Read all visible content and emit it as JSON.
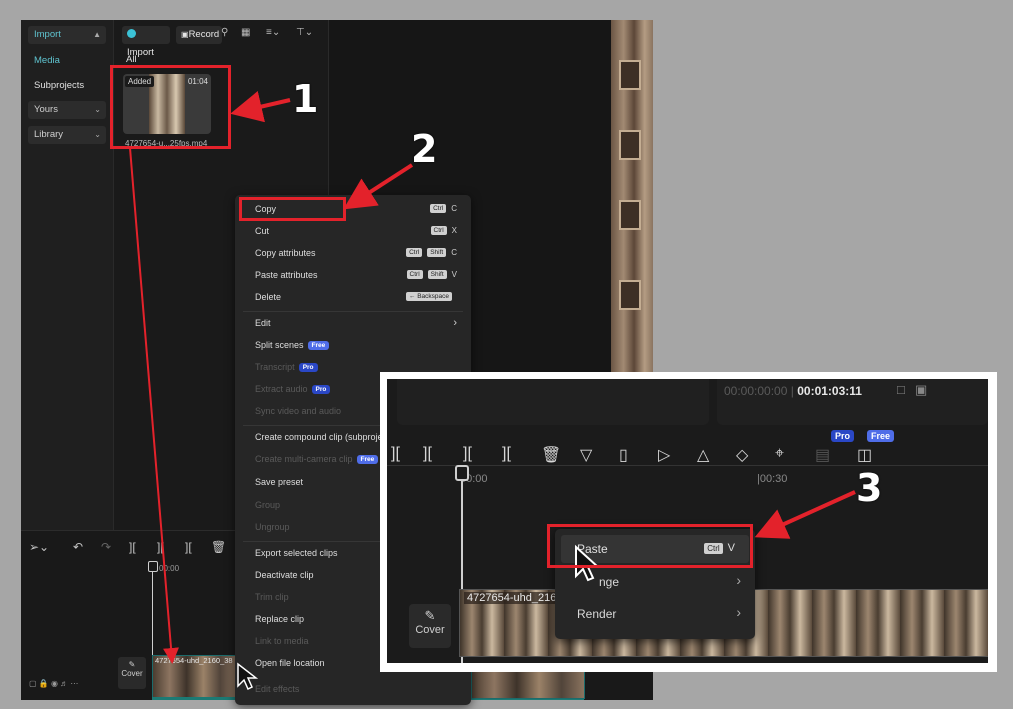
{
  "left_nav": {
    "import_label": "Import",
    "media_label": "Media",
    "subprojects_label": "Subprojects",
    "yours_label": "Yours",
    "library_label": "Library"
  },
  "media_toolbar": {
    "import_label": "Import",
    "record_label": "Record",
    "filter_all": "All"
  },
  "media_item": {
    "badge": "Added",
    "duration": "01:04",
    "filename": "4727654-u...25fps.mp4"
  },
  "context_menu": {
    "items": [
      {
        "label": "Copy",
        "key1": "Ctrl",
        "key2": "",
        "letter": "C"
      },
      {
        "label": "Cut",
        "key1": "Ctrl",
        "key2": "",
        "letter": "X"
      },
      {
        "label": "Copy attributes",
        "key1": "Ctrl",
        "key2": "Shift",
        "letter": "C"
      },
      {
        "label": "Paste attributes",
        "key1": "Ctrl",
        "key2": "Shift",
        "letter": "V"
      },
      {
        "label": "Delete",
        "shortcut": "← Backspace"
      },
      {
        "label": "Edit"
      },
      {
        "label": "Split scenes",
        "badge": "Free"
      },
      {
        "label": "Transcript",
        "badge": "Pro"
      },
      {
        "label": "Extract audio",
        "badge": "Pro"
      },
      {
        "label": "Sync video and audio"
      },
      {
        "label": "Create compound clip (subproje"
      },
      {
        "label": "Create multi-camera clip",
        "badge": "Free"
      },
      {
        "label": "Save preset"
      },
      {
        "label": "Group"
      },
      {
        "label": "Ungroup"
      },
      {
        "label": "Export selected clips"
      },
      {
        "label": "Deactivate clip"
      },
      {
        "label": "Trim clip"
      },
      {
        "label": "Replace clip"
      },
      {
        "label": "Link to media"
      },
      {
        "label": "Open file location"
      },
      {
        "label": "Edit effects"
      }
    ]
  },
  "timeline": {
    "time_start": "00:00",
    "clip_label": "4727654-uhd_2160_38",
    "cover_label": "Cover"
  },
  "inset": {
    "timecode_current": "00:00:00:00",
    "timecode_separator": "|",
    "timecode_total": "00:01:03:11",
    "badge_pro": "Pro",
    "badge_free": "Free",
    "ruler_start": "00:00",
    "ruler_mid": "|00:30",
    "clip_label": "4727654-uhd_216",
    "cover_label": "Cover",
    "menu": {
      "paste_label": "Paste",
      "paste_key": "Ctrl",
      "paste_letter": "V",
      "item2": "nge",
      "item3": "Render"
    }
  },
  "annotations": {
    "step1": "1",
    "step2": "2",
    "step3": "3",
    "color": "#e3222b"
  }
}
